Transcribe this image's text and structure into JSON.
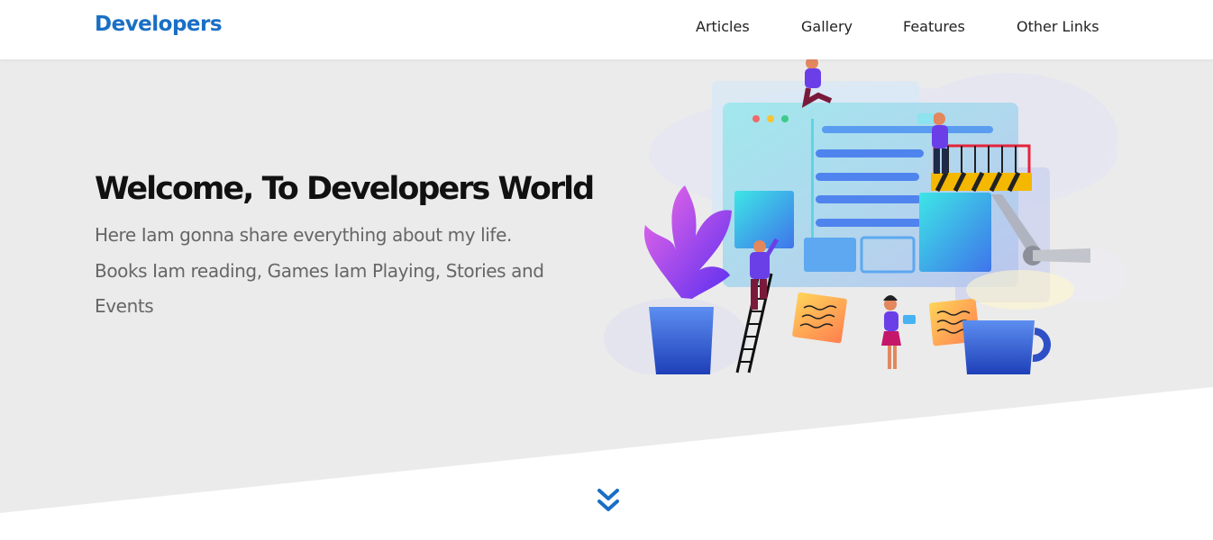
{
  "nav": {
    "brand": "Developers",
    "links": [
      "Articles",
      "Gallery",
      "Features",
      "Other Links"
    ]
  },
  "hero": {
    "title": "Welcome, To Developers World",
    "text": "Here Iam gonna share everything about my life. Books Iam reading, Games Iam Playing, Stories and Events"
  },
  "icons": {
    "scroll": "double-chevron-down-icon"
  },
  "colors": {
    "brand": "#1a6fc4",
    "hero_bg": "#ebebeb",
    "title": "#111111",
    "body_text": "#666666",
    "accent": "#1a6fc4"
  }
}
